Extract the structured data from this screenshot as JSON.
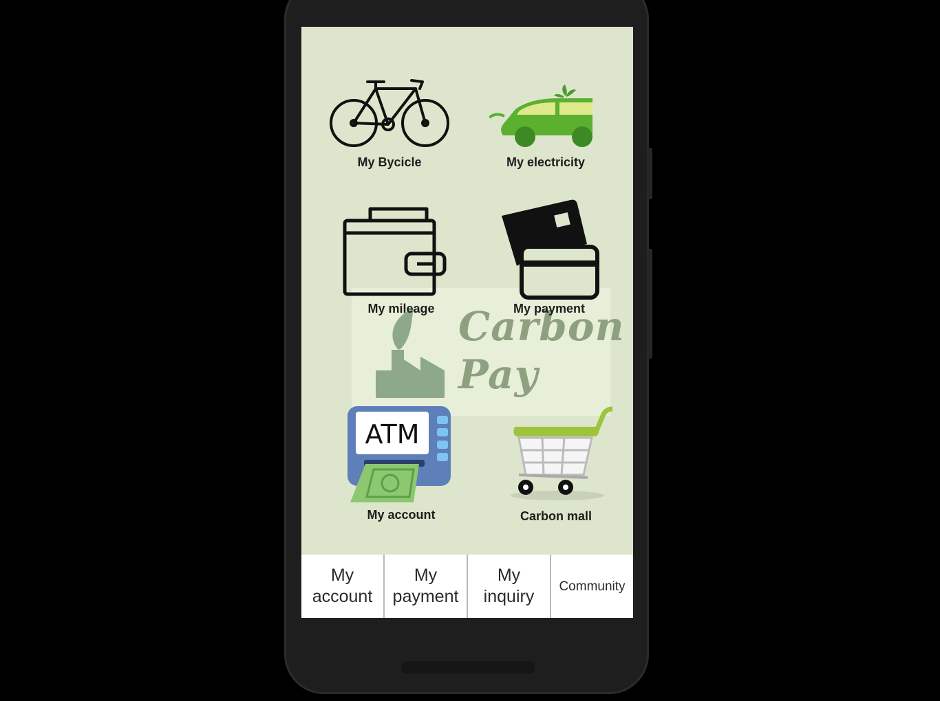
{
  "menu": {
    "bicycle_label": "My Bycicle",
    "electricity_label": "My electricity",
    "mileage_label": "My mileage",
    "payment_label": "My payment",
    "account_label": "My account",
    "mall_label": "Carbon mall"
  },
  "logo": {
    "line1": "Carbon",
    "line2": "Pay"
  },
  "atm_text": "ATM",
  "tabs": {
    "account": "My\naccount",
    "payment": "My\npayment",
    "inquiry": "My\ninquiry",
    "community": "Community"
  },
  "colors": {
    "screen_bg": "#dde6cc",
    "accent_green": "#5aa83a",
    "logo_green": "#8fa080"
  }
}
